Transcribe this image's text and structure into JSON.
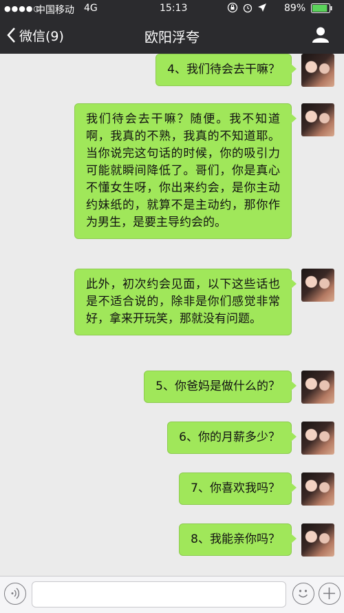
{
  "status_bar": {
    "signal": "●●●●○",
    "carrier": "中国移动",
    "network": "4G",
    "time": "15:13",
    "battery_percent": "89%",
    "battery_level": 0.89
  },
  "nav": {
    "back_label": "微信(9)",
    "title": "欧阳浮夸"
  },
  "messages": [
    "4、我们待会去干嘛？",
    "我们待会去干嘛？随便。我不知道啊，我真的不熟，我真的不知道耶。当你说完这句话的时候，你的吸引力可能就瞬间降低了。哥们，你是真心不懂女生呀，你出来约会，是你主动约妹纸的，就算不是主动约，那你作为男生，是要主导约会的。",
    "此外，初次约会见面，以下这些话也是不适合说的，除非是你们感觉非常好，拿来开玩笑，那就没有问题。",
    "5、你爸妈是做什么的？",
    "6、你的月薪多少？",
    "7、你喜欢我吗？",
    "8、我能亲你吗？"
  ],
  "colors": {
    "bubble": "#a0e75a",
    "bar": "#2b2b2e",
    "background": "#ebebeb"
  },
  "icons": {
    "back": "chevron-left-icon",
    "profile": "person-icon",
    "voice": "voice-icon",
    "emoji": "smiley-icon",
    "add": "plus-icon"
  }
}
